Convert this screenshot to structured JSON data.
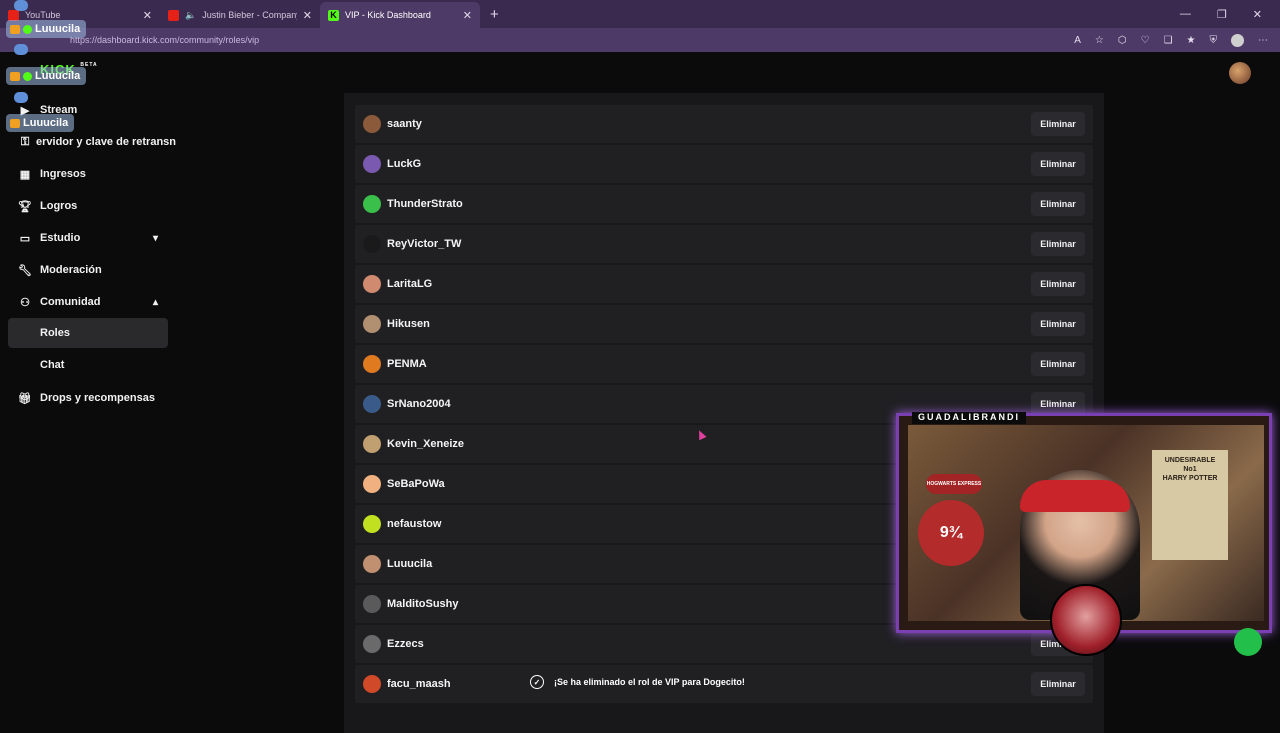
{
  "browser": {
    "tabs": [
      {
        "title": "YouTube",
        "icon": "youtube-icon",
        "active": false
      },
      {
        "title": "Justin Bieber - Company - You",
        "icon": "youtube-icon",
        "active": false
      },
      {
        "title": "VIP - Kick Dashboard",
        "icon": "kick-icon",
        "active": true
      }
    ],
    "new_tab": "+",
    "url": "https://dashboard.kick.com/community/roles/vip"
  },
  "overlay_chat": {
    "names": [
      "Luuucila",
      "Luuucila",
      "Luuucila"
    ]
  },
  "sidebar": {
    "logo_beta": "BETA",
    "items": [
      {
        "label": "Stream",
        "icon": "stream-icon"
      },
      {
        "label": "ervidor y clave de retransn",
        "icon": "server-icon"
      },
      {
        "label": "Ingresos",
        "icon": "chart-icon"
      },
      {
        "label": "Logros",
        "icon": "trophy-icon"
      },
      {
        "label": "Estudio",
        "icon": "studio-icon",
        "expandable": true,
        "expanded": false
      },
      {
        "label": "Moderación",
        "icon": "wrench-icon"
      },
      {
        "label": "Comunidad",
        "icon": "community-icon",
        "expandable": true,
        "expanded": true
      },
      {
        "label": "Roles",
        "sub": true,
        "active": true
      },
      {
        "label": "Chat",
        "sub": true
      },
      {
        "label": "Drops y recompensas",
        "icon": "gift-icon"
      }
    ]
  },
  "vip_list": {
    "remove_label": "Eliminar",
    "users": [
      {
        "name": "saanty",
        "color": "#8a5a3a"
      },
      {
        "name": "LuckG",
        "color": "#7a5ab0"
      },
      {
        "name": "ThunderStrato",
        "color": "#3ac04a"
      },
      {
        "name": "ReyVictor_TW",
        "color": "#1a1a1a"
      },
      {
        "name": "LaritaLG",
        "color": "#d08a70"
      },
      {
        "name": "Hikusen",
        "color": "#b09070"
      },
      {
        "name": "PENMA",
        "color": "#e07a20"
      },
      {
        "name": "SrNano2004",
        "color": "#3a5a8a"
      },
      {
        "name": "Kevin_Xeneize",
        "color": "#c0a070"
      },
      {
        "name": "SeBaPoWa",
        "color": "#f0b080"
      },
      {
        "name": "nefaustow",
        "color": "#c0e020"
      },
      {
        "name": "Luuucila",
        "color": "#c09070"
      },
      {
        "name": "MalditoSushy",
        "color": "#5a5a5a"
      },
      {
        "name": "Ezzecs",
        "color": "#6a6a6a"
      },
      {
        "name": "facu_maash",
        "color": "#d04a2a"
      }
    ]
  },
  "toast": {
    "message": "¡Se ha eliminado el rol de VIP para Dogecito!"
  },
  "webcam": {
    "label": "GUADALIBRANDI",
    "poster_text": "UNDESIRABLE\nNo1\nHARRY POTTER",
    "platform_text": "9¾",
    "hogwarts_text": "HOGWARTS EXPRESS"
  }
}
